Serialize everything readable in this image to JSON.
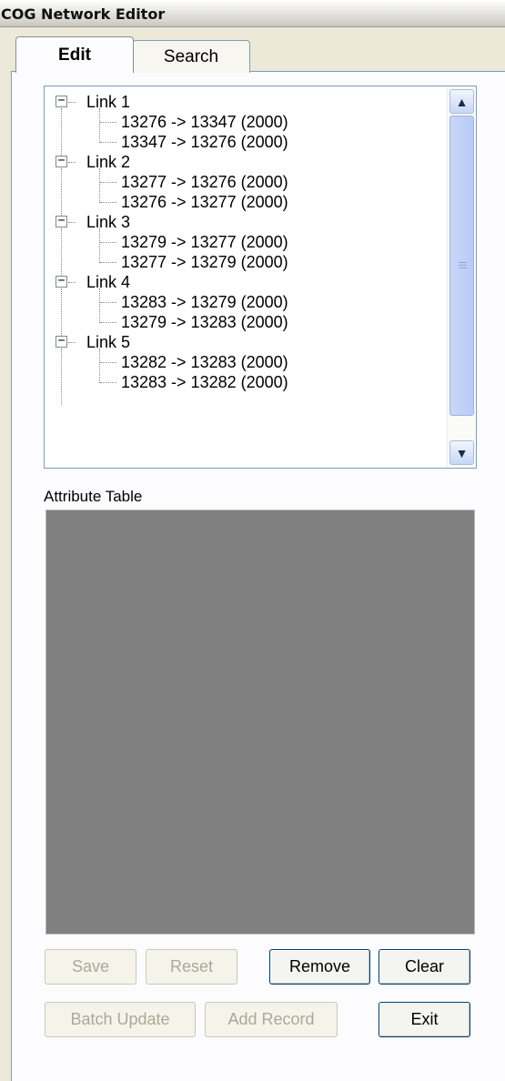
{
  "window": {
    "title": "COG Network Editor"
  },
  "tabs": [
    {
      "label": "Edit",
      "active": true
    },
    {
      "label": "Search",
      "active": false
    }
  ],
  "tree": {
    "groups": [
      {
        "label": "Link 1",
        "children": [
          "13276 -> 13347 (2000)",
          "13347 -> 13276 (2000)"
        ]
      },
      {
        "label": "Link 2",
        "children": [
          "13277 -> 13276 (2000)",
          "13276 -> 13277 (2000)"
        ]
      },
      {
        "label": "Link 3",
        "children": [
          "13279 -> 13277 (2000)",
          "13277 -> 13279 (2000)"
        ]
      },
      {
        "label": "Link 4",
        "children": [
          "13283 -> 13279 (2000)",
          "13279 -> 13283 (2000)"
        ]
      },
      {
        "label": "Link 5",
        "children": [
          "13282 -> 13283 (2000)",
          "13283 -> 13282 (2000)"
        ]
      }
    ],
    "expander_symbol": "−"
  },
  "attribute_table": {
    "label": "Attribute Table"
  },
  "buttons": {
    "save": "Save",
    "reset": "Reset",
    "remove": "Remove",
    "clear": "Clear",
    "batch_update": "Batch Update",
    "add_record": "Add Record",
    "exit": "Exit"
  },
  "icons": {
    "scroll_up": "scroll-up-arrow-icon",
    "scroll_down": "scroll-down-arrow-icon",
    "collapse": "collapse-minus-icon"
  },
  "colors": {
    "attribute_table_bg": "#808080",
    "tab_border": "#7f9db9",
    "disabled_text": "#aca899"
  }
}
